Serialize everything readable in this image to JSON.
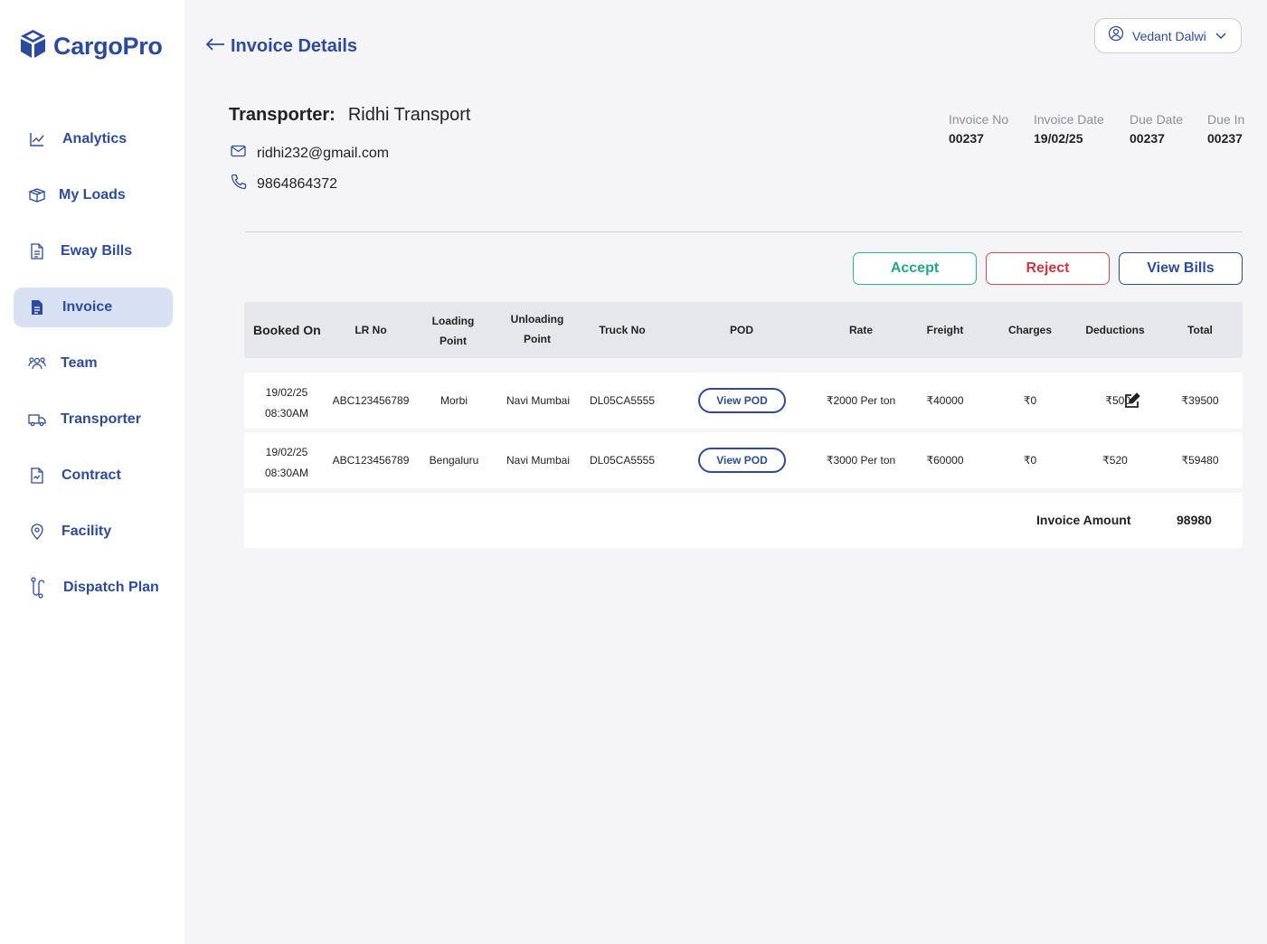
{
  "app": {
    "name": "CargoPro"
  },
  "sidebar": {
    "items": [
      {
        "label": "Analytics",
        "icon": "chart-line-icon",
        "active": false
      },
      {
        "label": "My Loads",
        "icon": "box-icon",
        "active": false
      },
      {
        "label": "Eway Bills",
        "icon": "document-icon",
        "active": false
      },
      {
        "label": "Invoice",
        "icon": "invoice-icon",
        "active": true
      },
      {
        "label": "Team",
        "icon": "team-icon",
        "active": false
      },
      {
        "label": "Transporter",
        "icon": "truck-icon",
        "active": false
      },
      {
        "label": "Contract",
        "icon": "contract-icon",
        "active": false
      },
      {
        "label": "Facility",
        "icon": "location-pin-icon",
        "active": false
      },
      {
        "label": "Dispatch Plan",
        "icon": "route-icon",
        "active": false
      }
    ]
  },
  "header": {
    "title": "Invoice Details",
    "user": "Vedant Dalwi"
  },
  "transporter": {
    "label": "Transporter:",
    "name": "Ridhi Transport",
    "email": "ridhi232@gmail.com",
    "phone": "9864864372"
  },
  "invoice_meta": [
    {
      "label": "Invoice No",
      "value": "00237"
    },
    {
      "label": "Invoice Date",
      "value": "19/02/25"
    },
    {
      "label": "Due Date",
      "value": "00237"
    },
    {
      "label": "Due In",
      "value": "00237"
    }
  ],
  "actions": {
    "accept": "Accept",
    "reject": "Reject",
    "view_bills": "View Bills"
  },
  "table": {
    "headers": {
      "booked_on": "Booked On",
      "lr_no": "LR No",
      "loading_1": "Loading",
      "loading_2": "Point",
      "unloading_1": "Unloading",
      "unloading_2": "Point",
      "truck_no": "Truck No",
      "pod": "POD",
      "rate": "Rate",
      "freight": "Freight",
      "charges": "Charges",
      "deductions": "Deductions",
      "total": "Total"
    },
    "rows": [
      {
        "date": "19/02/25",
        "time": "08:30AM",
        "lr_no": "ABC123456789",
        "loading": "Morbi",
        "unloading": "Navi Mumbai",
        "truck": "DL05CA5555",
        "pod": "View POD",
        "rate": "₹2000 Per ton",
        "freight": "₹40000",
        "charges": "₹0",
        "deductions": "₹500",
        "total": "₹39500"
      },
      {
        "date": "19/02/25",
        "time": "08:30AM",
        "lr_no": "ABC123456789",
        "loading": "Bengaluru",
        "unloading": "Navi Mumbai",
        "truck": "DL05CA5555",
        "pod": "View POD",
        "rate": "₹3000 Per ton",
        "freight": "₹60000",
        "charges": "₹0",
        "deductions": "₹520",
        "total": "₹59480"
      }
    ],
    "invoice_amount_label": "Invoice Amount",
    "invoice_amount": "98980"
  },
  "colors": {
    "brand": "#2c4ba0",
    "accept": "#1fa88e",
    "reject": "#cf3441",
    "active_bg": "#d8e1f4",
    "page_bg": "#f5f5f7"
  }
}
